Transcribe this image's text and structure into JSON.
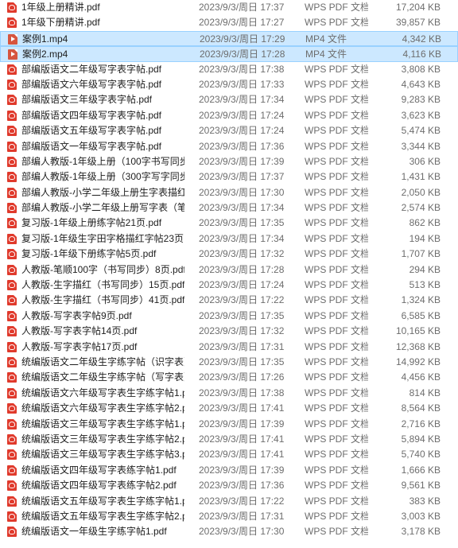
{
  "files": [
    {
      "name": "1年级上册精讲.pdf",
      "date": "2023/9/3/周日 17:37",
      "type": "WPS PDF 文档",
      "size": "17,204 KB",
      "icon": "pdf-file-icon",
      "selected": false
    },
    {
      "name": "1年级下册精讲.pdf",
      "date": "2023/9/3/周日 17:27",
      "type": "WPS PDF 文档",
      "size": "39,857 KB",
      "icon": "pdf-file-icon",
      "selected": false
    },
    {
      "name": "案例1.mp4",
      "date": "2023/9/3/周日 17:29",
      "type": "MP4 文件",
      "size": "4,342 KB",
      "icon": "mp4-file-icon",
      "selected": true
    },
    {
      "name": "案例2.mp4",
      "date": "2023/9/3/周日 17:28",
      "type": "MP4 文件",
      "size": "4,116 KB",
      "icon": "mp4-file-icon",
      "selected": true
    },
    {
      "name": "部编版语文二年级写字表字帖.pdf",
      "date": "2023/9/3/周日 17:38",
      "type": "WPS PDF 文档",
      "size": "3,808 KB",
      "icon": "pdf-file-icon",
      "selected": false
    },
    {
      "name": "部编版语文六年级写字表字帖.pdf",
      "date": "2023/9/3/周日 17:33",
      "type": "WPS PDF 文档",
      "size": "4,643 KB",
      "icon": "pdf-file-icon",
      "selected": false
    },
    {
      "name": "部编版语文三年级字表字帖.pdf",
      "date": "2023/9/3/周日 17:34",
      "type": "WPS PDF 文档",
      "size": "9,283 KB",
      "icon": "pdf-file-icon",
      "selected": false
    },
    {
      "name": "部编版语文四年级写字表字帖.pdf",
      "date": "2023/9/3/周日 17:24",
      "type": "WPS PDF 文档",
      "size": "3,623 KB",
      "icon": "pdf-file-icon",
      "selected": false
    },
    {
      "name": "部编版语文五年级写字表字帖.pdf",
      "date": "2023/9/3/周日 17:24",
      "type": "WPS PDF 文档",
      "size": "5,474 KB",
      "icon": "pdf-file-icon",
      "selected": false
    },
    {
      "name": "部编版语文一年级写字表字帖.pdf",
      "date": "2023/9/3/周日 17:36",
      "type": "WPS PDF 文档",
      "size": "3,344 KB",
      "icon": "pdf-file-icon",
      "selected": false
    },
    {
      "name": "部编人教版-1年级上册（100字书写同步...",
      "date": "2023/9/3/周日 17:39",
      "type": "WPS PDF 文档",
      "size": "306 KB",
      "icon": "pdf-file-icon",
      "selected": false
    },
    {
      "name": "部编人教版-1年级上册（300字写字同步...",
      "date": "2023/9/3/周日 17:37",
      "type": "WPS PDF 文档",
      "size": "1,431 KB",
      "icon": "pdf-file-icon",
      "selected": false
    },
    {
      "name": "部编人教版-小学二年级上册生字表描红...",
      "date": "2023/9/3/周日 17:30",
      "type": "WPS PDF 文档",
      "size": "2,050 KB",
      "icon": "pdf-file-icon",
      "selected": false
    },
    {
      "name": "部编人教版-小学二年级上册写字表（笔...",
      "date": "2023/9/3/周日 17:34",
      "type": "WPS PDF 文档",
      "size": "2,574 KB",
      "icon": "pdf-file-icon",
      "selected": false
    },
    {
      "name": "复习版-1年级上册练字帖21页.pdf",
      "date": "2023/9/3/周日 17:35",
      "type": "WPS PDF 文档",
      "size": "862 KB",
      "icon": "pdf-file-icon",
      "selected": false
    },
    {
      "name": "复习版-1年级生字田字格描红字帖23页.p...",
      "date": "2023/9/3/周日 17:34",
      "type": "WPS PDF 文档",
      "size": "194 KB",
      "icon": "pdf-file-icon",
      "selected": false
    },
    {
      "name": "复习版-1年级下册练字帖5页.pdf",
      "date": "2023/9/3/周日 17:32",
      "type": "WPS PDF 文档",
      "size": "1,707 KB",
      "icon": "pdf-file-icon",
      "selected": false
    },
    {
      "name": "人教版-笔顺100字（书写同步）8页.pdf",
      "date": "2023/9/3/周日 17:28",
      "type": "WPS PDF 文档",
      "size": "294 KB",
      "icon": "pdf-file-icon",
      "selected": false
    },
    {
      "name": "人教版-生字描红（书写同步）15页.pdf",
      "date": "2023/9/3/周日 17:24",
      "type": "WPS PDF 文档",
      "size": "513 KB",
      "icon": "pdf-file-icon",
      "selected": false
    },
    {
      "name": "人教版-生字描红（书写同步）41页.pdf",
      "date": "2023/9/3/周日 17:22",
      "type": "WPS PDF 文档",
      "size": "1,324 KB",
      "icon": "pdf-file-icon",
      "selected": false
    },
    {
      "name": "人教版-写字表字帖9页.pdf",
      "date": "2023/9/3/周日 17:35",
      "type": "WPS PDF 文档",
      "size": "6,585 KB",
      "icon": "pdf-file-icon",
      "selected": false
    },
    {
      "name": "人教版-写字表字帖14页.pdf",
      "date": "2023/9/3/周日 17:32",
      "type": "WPS PDF 文档",
      "size": "10,165 KB",
      "icon": "pdf-file-icon",
      "selected": false
    },
    {
      "name": "人教版-写字表字帖17页.pdf",
      "date": "2023/9/3/周日 17:31",
      "type": "WPS PDF 文档",
      "size": "12,368 KB",
      "icon": "pdf-file-icon",
      "selected": false
    },
    {
      "name": "统编版语文二年级生字练字帖（识字表）...",
      "date": "2023/9/3/周日 17:35",
      "type": "WPS PDF 文档",
      "size": "14,992 KB",
      "icon": "pdf-file-icon",
      "selected": false
    },
    {
      "name": "统编版语文二年级生字练字帖（写字表）...",
      "date": "2023/9/3/周日 17:26",
      "type": "WPS PDF 文档",
      "size": "4,456 KB",
      "icon": "pdf-file-icon",
      "selected": false
    },
    {
      "name": "统编版语文六年级写字表生字练字帖1.pdf",
      "date": "2023/9/3/周日 17:38",
      "type": "WPS PDF 文档",
      "size": "814 KB",
      "icon": "pdf-file-icon",
      "selected": false
    },
    {
      "name": "统编版语文六年级写字表生字练字帖2.pdf",
      "date": "2023/9/3/周日 17:41",
      "type": "WPS PDF 文档",
      "size": "8,564 KB",
      "icon": "pdf-file-icon",
      "selected": false
    },
    {
      "name": "统编版语文三年级写字表生字练字帖1.pdf",
      "date": "2023/9/3/周日 17:39",
      "type": "WPS PDF 文档",
      "size": "2,716 KB",
      "icon": "pdf-file-icon",
      "selected": false
    },
    {
      "name": "统编版语文三年级写字表生字练字帖2.pdf",
      "date": "2023/9/3/周日 17:41",
      "type": "WPS PDF 文档",
      "size": "5,894 KB",
      "icon": "pdf-file-icon",
      "selected": false
    },
    {
      "name": "统编版语文三年级写字表生字练字帖3.pdf",
      "date": "2023/9/3/周日 17:41",
      "type": "WPS PDF 文档",
      "size": "5,740 KB",
      "icon": "pdf-file-icon",
      "selected": false
    },
    {
      "name": "统编版语文四年级写字表练字帖1.pdf",
      "date": "2023/9/3/周日 17:39",
      "type": "WPS PDF 文档",
      "size": "1,666 KB",
      "icon": "pdf-file-icon",
      "selected": false
    },
    {
      "name": "统编版语文四年级写字表练字帖2.pdf",
      "date": "2023/9/3/周日 17:36",
      "type": "WPS PDF 文档",
      "size": "9,561 KB",
      "icon": "pdf-file-icon",
      "selected": false
    },
    {
      "name": "统编版语文五年级写字表生字练字帖1.pdf",
      "date": "2023/9/3/周日 17:22",
      "type": "WPS PDF 文档",
      "size": "383 KB",
      "icon": "pdf-file-icon",
      "selected": false
    },
    {
      "name": "统编版语文五年级写字表生字练字帖2.pdf",
      "date": "2023/9/3/周日 17:31",
      "type": "WPS PDF 文档",
      "size": "3,003 KB",
      "icon": "pdf-file-icon",
      "selected": false
    },
    {
      "name": "统编版语文一年级生字练字帖1.pdf",
      "date": "2023/9/3/周日 17:30",
      "type": "WPS PDF 文档",
      "size": "3,178 KB",
      "icon": "pdf-file-icon",
      "selected": false
    }
  ],
  "colors": {
    "selection_bg": "#cce8ff",
    "selection_border": "#99d1ff",
    "pdf_icon": "#e03a2c",
    "meta_text": "#6d6d6d"
  }
}
